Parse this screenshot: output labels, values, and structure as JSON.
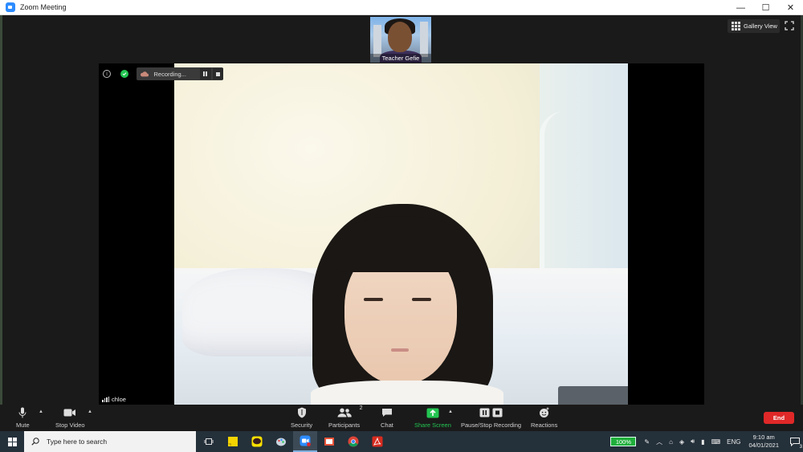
{
  "window": {
    "title": "Zoom Meeting",
    "controls": [
      "—",
      "☐",
      "✕"
    ]
  },
  "thumbnail": {
    "name": "Teacher Gefie"
  },
  "view": {
    "gallery_label": "Gallery View"
  },
  "recording": {
    "status": "Recording..."
  },
  "participant": {
    "name": "chloe"
  },
  "toolbar": {
    "mute": "Mute",
    "stop_video": "Stop Video",
    "security": "Security",
    "participants": "Participants",
    "participants_count": "2",
    "chat": "Chat",
    "share_screen": "Share Screen",
    "pause_stop_recording": "Pause/Stop Recording",
    "reactions": "Reactions",
    "end": "End"
  },
  "taskbar": {
    "search_placeholder": "Type here to search",
    "battery": "100%",
    "language": "ENG",
    "time": "9:10 am",
    "date": "04/01/2021",
    "notification_count": "3",
    "apps": [
      "task-view",
      "sticky-notes",
      "kakaotalk",
      "paint",
      "zoom",
      "photos",
      "chrome",
      "acrobat"
    ]
  },
  "colors": {
    "end_red": "#e02828",
    "share_green": "#23c552",
    "accent_blue": "#2d8cff",
    "taskbar": "#24303a"
  }
}
